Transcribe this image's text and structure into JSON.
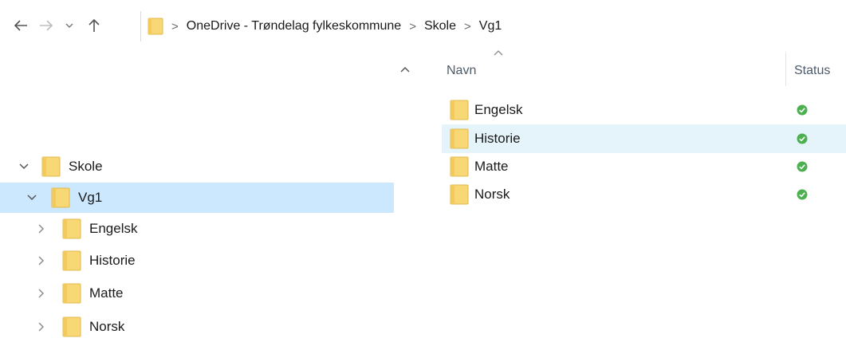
{
  "toolbar": {
    "back_icon": "arrow-left-icon",
    "forward_icon": "arrow-right-icon",
    "recent_icon": "chevron-down-icon",
    "up_icon": "arrow-up-icon"
  },
  "address_bar": {
    "crumbs": [
      "OneDrive - Trøndelag fylkeskommune",
      "Skole",
      "Vg1"
    ],
    "separator": ">"
  },
  "navigation_pane": {
    "items": [
      {
        "label": "Skole",
        "expanded": true,
        "selected": false
      },
      {
        "label": "Vg1",
        "expanded": true,
        "selected": true
      },
      {
        "label": "Engelsk",
        "expanded": false,
        "selected": false
      },
      {
        "label": "Historie",
        "expanded": false,
        "selected": false
      },
      {
        "label": "Matte",
        "expanded": false,
        "selected": false
      },
      {
        "label": "Norsk",
        "expanded": false,
        "selected": false
      }
    ]
  },
  "file_list": {
    "columns": {
      "name": "Navn",
      "status": "Status"
    },
    "sorted_by": "Navn",
    "rows": [
      {
        "name": "Engelsk",
        "status": "synced",
        "hovered": false
      },
      {
        "name": "Historie",
        "status": "synced",
        "hovered": true
      },
      {
        "name": "Matte",
        "status": "synced",
        "hovered": false
      },
      {
        "name": "Norsk",
        "status": "synced",
        "hovered": false
      }
    ]
  },
  "colors": {
    "selection": "#cce8ff",
    "hover": "#e5f3fb",
    "folder": "#f8d775",
    "status_green": "#4caf50"
  }
}
